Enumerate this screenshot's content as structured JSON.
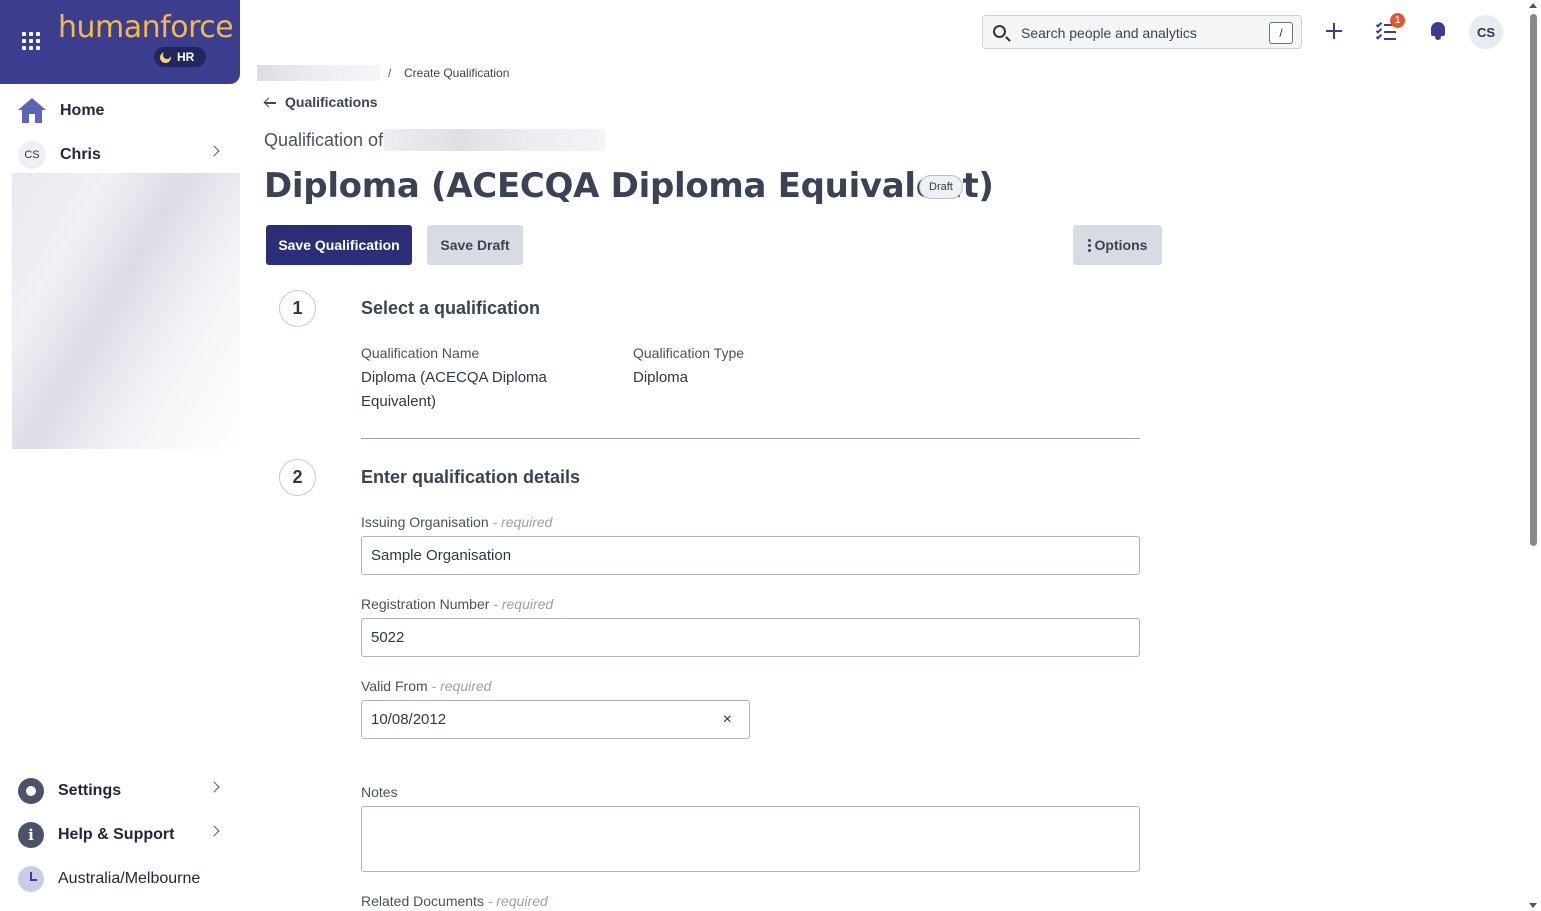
{
  "brand": {
    "logo": "humanforce",
    "badge": "HR"
  },
  "sidebar": {
    "items": [
      {
        "label": "Home",
        "icon": "home-icon"
      },
      {
        "label": "Chris",
        "icon": "avatar-initials",
        "initials": "CS"
      }
    ],
    "bottom": [
      {
        "label": "Settings",
        "icon": "gear-icon"
      },
      {
        "label": "Help & Support",
        "icon": "info-icon"
      }
    ],
    "timezone": "Australia/Melbourne"
  },
  "topbar": {
    "search_placeholder": "Search people and analytics",
    "search_shortcut": "/",
    "task_count": "1",
    "avatar_initials": "CS"
  },
  "breadcrumb": {
    "separator": "/",
    "current": "Create Qualification"
  },
  "back_link": "Qualifications",
  "header": {
    "subtitle": "Qualification of",
    "title": "Diploma (ACECQA Diploma Equivalent)",
    "status": "Draft"
  },
  "actions": {
    "save": "Save Qualification",
    "save_draft": "Save Draft",
    "options": "Options"
  },
  "step1": {
    "number": "1",
    "title": "Select a qualification",
    "name_label": "Qualification Name",
    "name_value_line1": "Diploma (ACECQA Diploma",
    "name_value_line2": "Equivalent)",
    "type_label": "Qualification Type",
    "type_value": "Diploma"
  },
  "step2": {
    "number": "2",
    "title": "Enter qualification details",
    "required_suffix": "- required",
    "issuing_label": "Issuing Organisation",
    "issuing_value": "Sample Organisation",
    "registration_label": "Registration Number",
    "registration_value": "5022",
    "valid_from_label": "Valid From",
    "valid_from_value": "10/08/2012",
    "clear_glyph": "×",
    "notes_label": "Notes",
    "notes_value": "",
    "related_label": "Related Documents"
  },
  "colors": {
    "brand_bg": "#3b3e8f",
    "logo": "#f2b84b",
    "primary_button": "#2b2f78",
    "secondary_button": "#d7dbe3",
    "notification": "#e4572e"
  }
}
